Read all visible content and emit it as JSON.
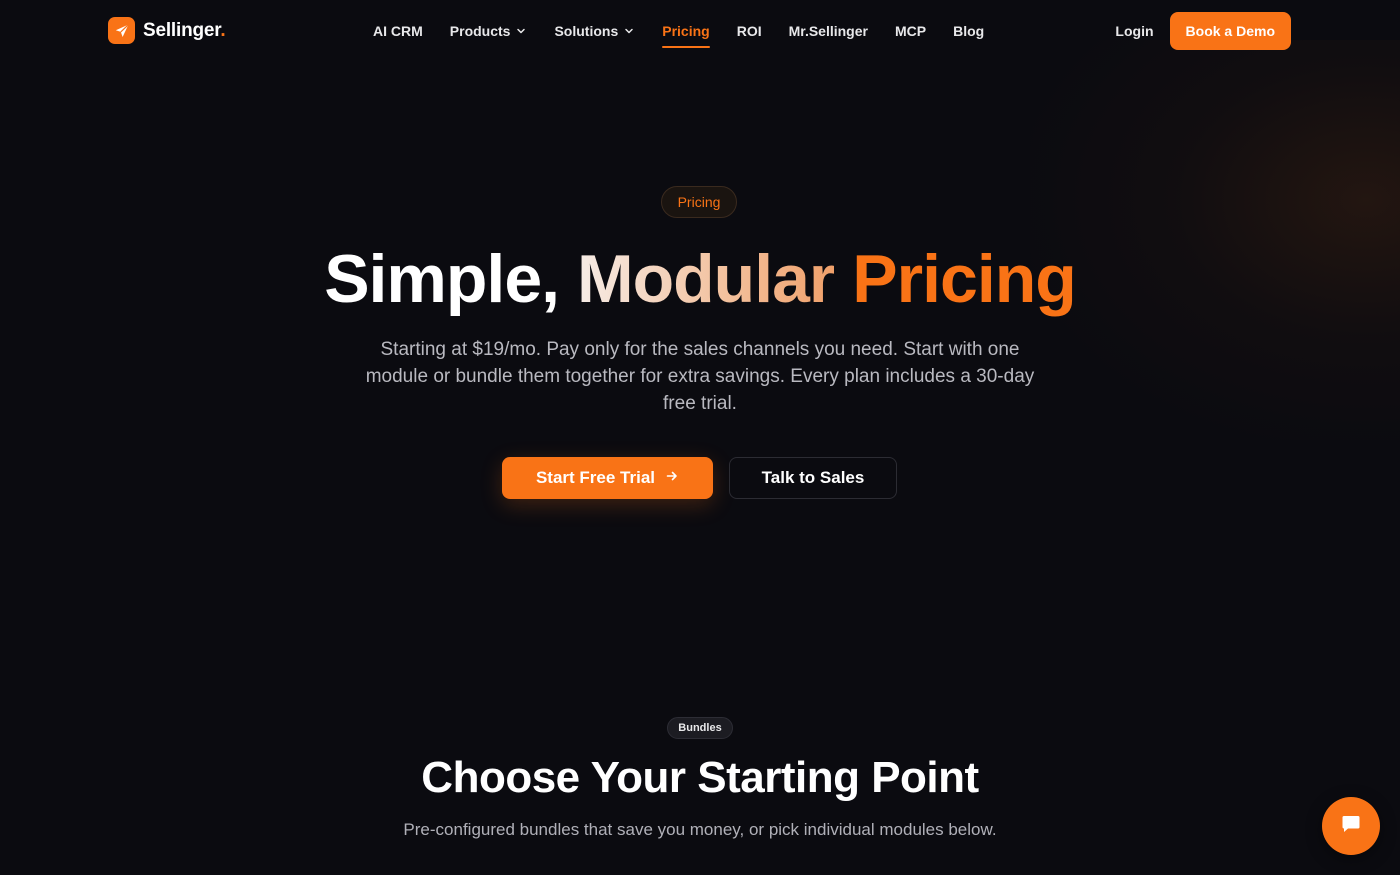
{
  "brand": {
    "name": "Sellinger",
    "dot": ".",
    "logo_icon": "paper-plane-icon"
  },
  "nav": {
    "items": [
      {
        "label": "AI CRM",
        "dropdown": false
      },
      {
        "label": "Products",
        "dropdown": true
      },
      {
        "label": "Solutions",
        "dropdown": true
      },
      {
        "label": "Pricing",
        "dropdown": false,
        "active": true
      },
      {
        "label": "ROI",
        "dropdown": false
      },
      {
        "label": "Mr.Sellinger",
        "dropdown": false
      },
      {
        "label": "MCP",
        "dropdown": false
      },
      {
        "label": "Blog",
        "dropdown": false
      }
    ],
    "login_label": "Login",
    "demo_label": "Book a Demo"
  },
  "hero": {
    "badge": "Pricing",
    "title_part1": "Simple,",
    "title_part2": "Modular",
    "title_part3": "Pricing",
    "subtitle": "Starting at $19/mo. Pay only for the sales channels you need. Start with one module or bundle them together for extra savings. Every plan includes a 30-day free trial.",
    "primary_cta": "Start Free Trial",
    "primary_cta_icon": "arrow-right-icon",
    "secondary_cta": "Talk to Sales"
  },
  "bundles": {
    "badge": "Bundles",
    "title": "Choose Your Starting Point",
    "subtitle": "Pre-configured bundles that save you money, or pick individual modules below."
  },
  "chat": {
    "icon": "chat-bubble-icon"
  },
  "colors": {
    "accent": "#f97316",
    "background": "#0b0b10"
  }
}
